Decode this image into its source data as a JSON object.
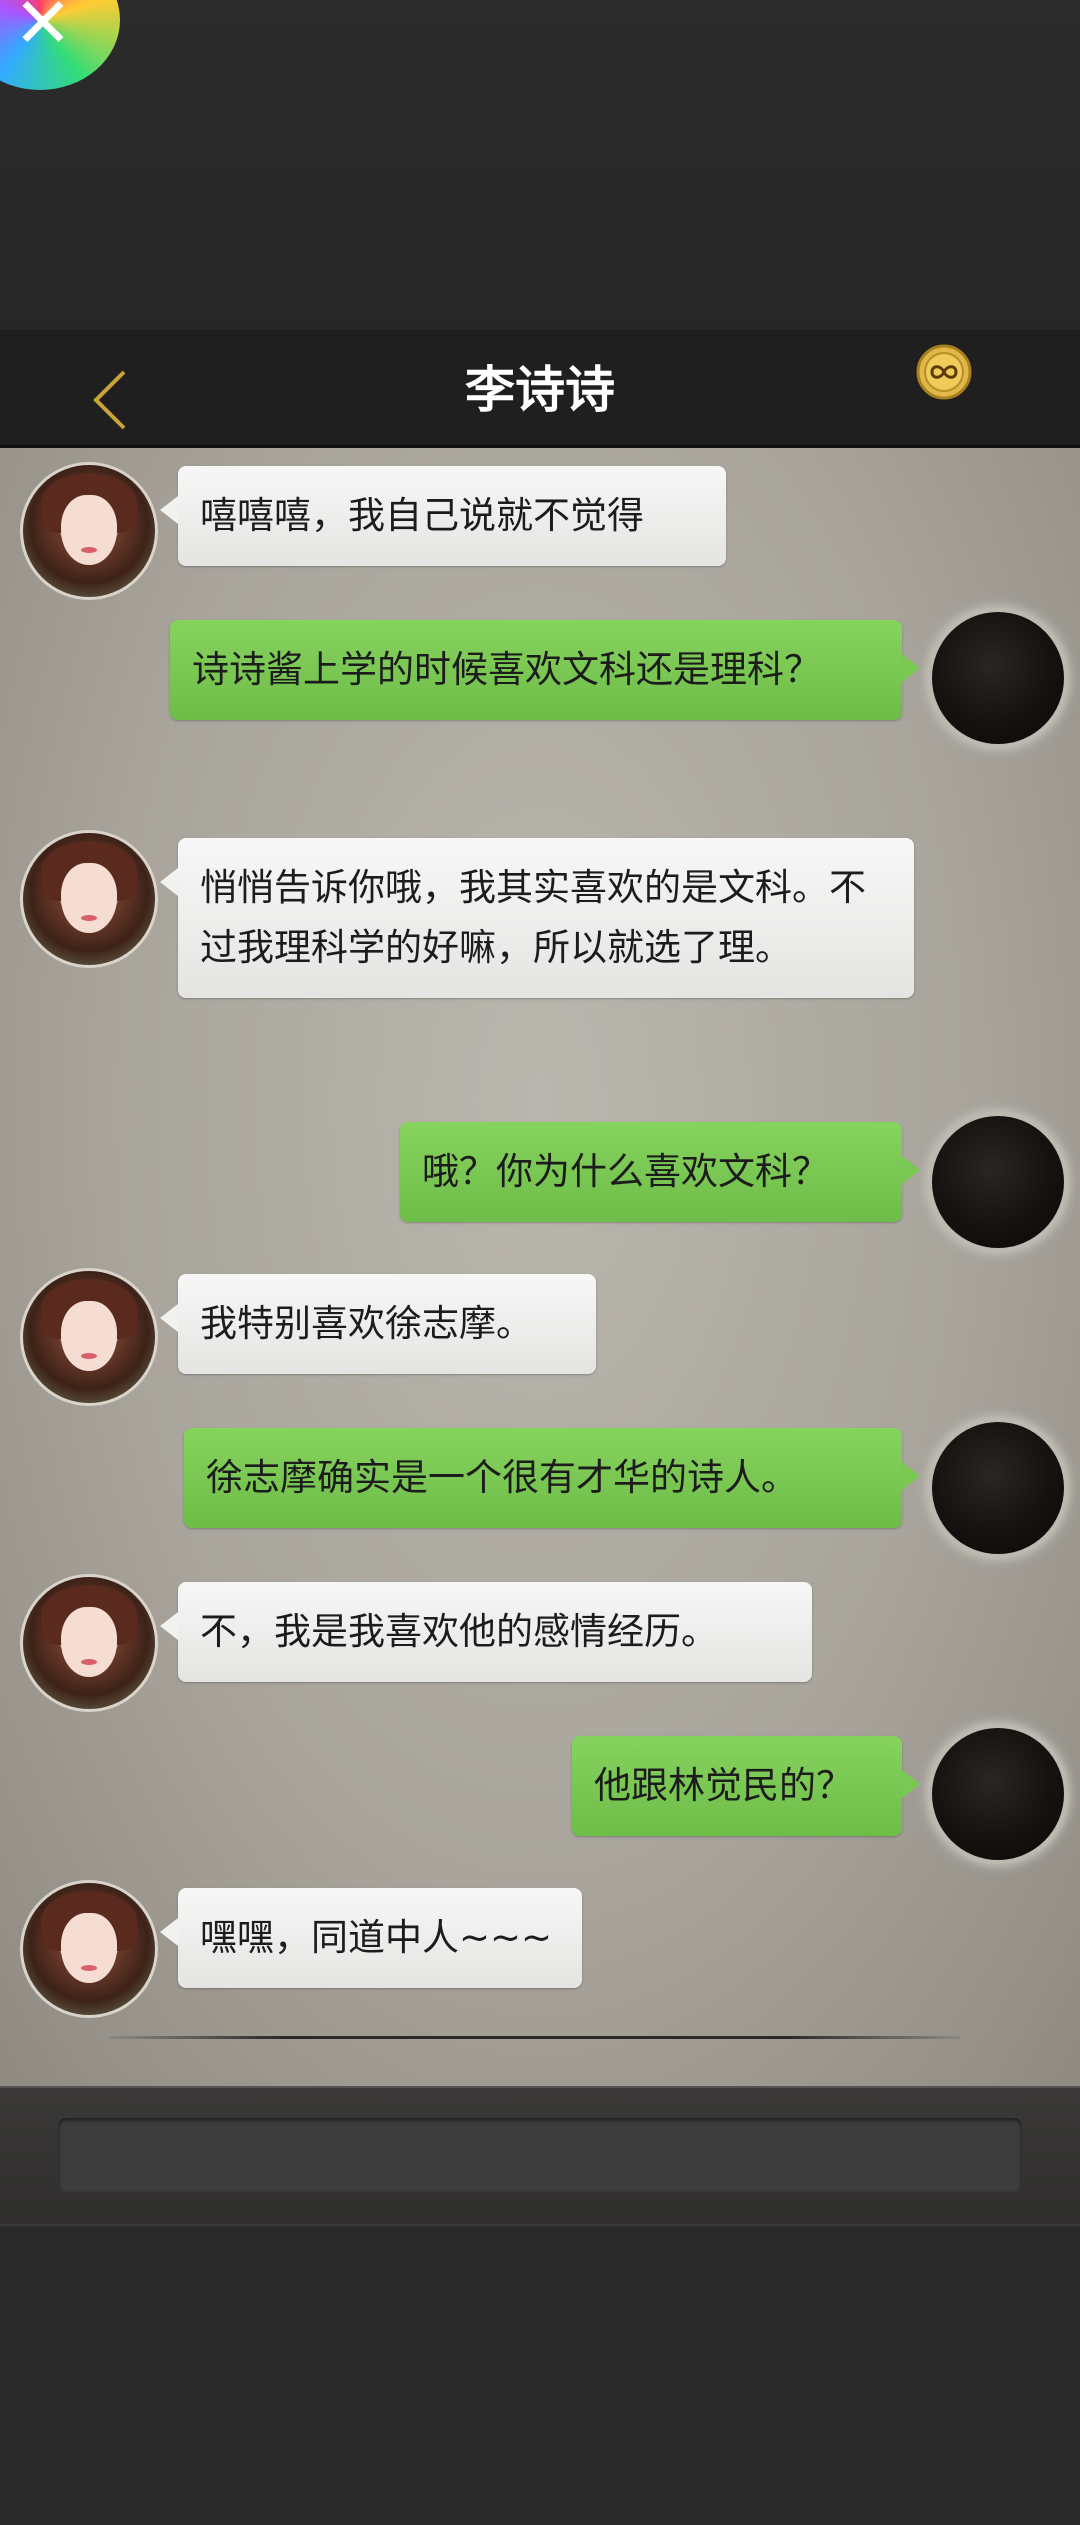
{
  "header": {
    "title": "李诗诗",
    "back_icon": "chevron-left-icon",
    "badge_icon": "infinity-coin-icon"
  },
  "messages": [
    {
      "from": "contact",
      "text": "嘻嘻嘻，我自己说就不觉得"
    },
    {
      "from": "me",
      "text": "诗诗酱上学的时候喜欢文科还是理科？"
    },
    {
      "from": "contact",
      "text": "悄悄告诉你哦，我其实喜欢的是文科。不过我理科学的好嘛，所以就选了理。"
    },
    {
      "from": "me",
      "text": "哦？你为什么喜欢文科？"
    },
    {
      "from": "contact",
      "text": "我特别喜欢徐志摩。"
    },
    {
      "from": "me",
      "text": "徐志摩确实是一个很有才华的诗人。"
    },
    {
      "from": "contact",
      "text": "不，我是我喜欢他的感情经历。"
    },
    {
      "from": "me",
      "text": "他跟林觉民的？"
    },
    {
      "from": "contact",
      "text": "嘿嘿，同道中人~~~"
    }
  ],
  "input": {
    "value": "",
    "placeholder": ""
  },
  "colors": {
    "outgoing_bubble": "#79c853",
    "incoming_bubble": "#f1f1f0",
    "header_bg": "#1f1f1f",
    "accent_gold": "#c9a23a"
  }
}
